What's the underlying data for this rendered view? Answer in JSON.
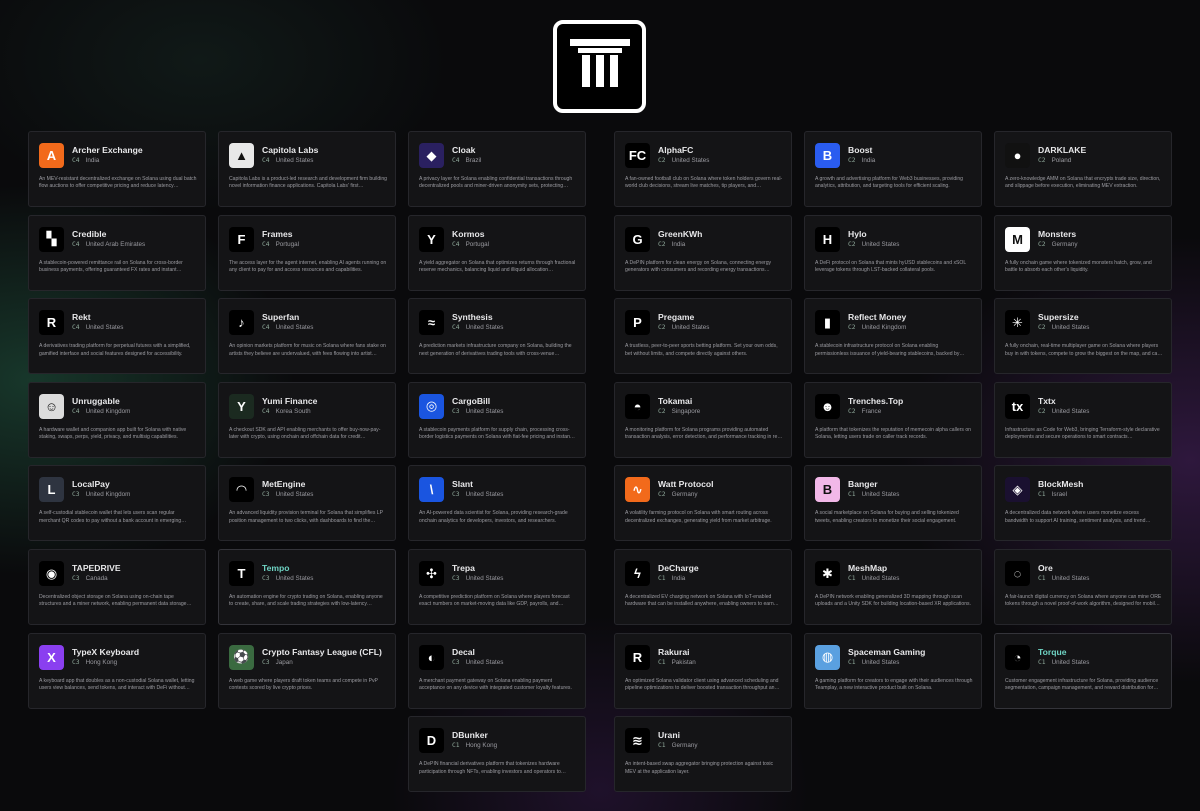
{
  "logo": {
    "name": "pillars-logo-icon"
  },
  "cards": [
    {
      "name": "Archer Exchange",
      "tier": "C4",
      "country": "India",
      "desc": "An MEV-resistant decentralized exchange on Solana using dual batch flow auctions to offer competitive pricing and reduce latency…",
      "icon": "archer-icon",
      "color": "#f26a1b",
      "glyph": "A"
    },
    {
      "name": "Capitola Labs",
      "tier": "C4",
      "country": "United States",
      "desc": "Capitola Labs is a product-led research and development firm building novel information finance applications. Capitola Labs' first…",
      "icon": "capitola-icon",
      "color": "#e8e8e8",
      "glyph": "▲"
    },
    {
      "name": "Cloak",
      "tier": "C4",
      "country": "Brazil",
      "desc": "A privacy layer for Solana enabling confidential transactions through decentralized pools and miner-driven anonymity sets, protecting…",
      "icon": "cloak-icon",
      "color": "#2a2060",
      "glyph": "◆"
    },
    {
      "name": "AlphaFC",
      "tier": "C2",
      "country": "United States",
      "desc": "A fan-owned football club on Solana where token holders govern real-world club decisions, stream live matches, tip players, and…",
      "icon": "alphafc-icon",
      "color": "#000000",
      "glyph": "FC"
    },
    {
      "name": "Boost",
      "tier": "C2",
      "country": "India",
      "desc": "A growth and advertising platform for Web3 businesses, providing analytics, attribution, and targeting tools for efficient scaling.",
      "icon": "boost-icon",
      "color": "#2a5cf0",
      "glyph": "B"
    },
    {
      "name": "DARKLAKE",
      "tier": "C2",
      "country": "Poland",
      "desc": "A zero-knowledge AMM on Solana that encrypts trade size, direction, and slippage before execution, eliminating MEV extraction.",
      "icon": "darklake-icon",
      "color": "#111111",
      "glyph": "●"
    },
    {
      "name": "Credible",
      "tier": "C4",
      "country": "United Arab Emirates",
      "desc": "A stablecoin-powered remittance rail on Solana for cross-border business payments, offering guaranteed FX rates and instant…",
      "icon": "credible-icon",
      "color": "#000000",
      "glyph": "▚"
    },
    {
      "name": "Frames",
      "tier": "C4",
      "country": "Portugal",
      "desc": "The access layer for the agent internet, enabling AI agents running on any client to pay for and access resources and capabilities.",
      "icon": "frames-icon",
      "color": "#000000",
      "glyph": "F"
    },
    {
      "name": "Kormos",
      "tier": "C4",
      "country": "Portugal",
      "desc": "A yield aggregator on Solana that optimizes returns through fractional reserve mechanics, balancing liquid and illiquid allocation…",
      "icon": "kormos-icon",
      "color": "#000000",
      "glyph": "Y"
    },
    {
      "name": "GreenKWh",
      "tier": "C2",
      "country": "India",
      "desc": "A DePIN platform for clean energy on Solana, connecting energy generators with consumers and recording energy transactions…",
      "icon": "greenkwh-icon",
      "color": "#000000",
      "glyph": "G"
    },
    {
      "name": "Hylo",
      "tier": "C2",
      "country": "United States",
      "desc": "A DeFi protocol on Solana that mints hyUSD stablecoins and xSOL leverage tokens through LST-backed collateral pools.",
      "icon": "hylo-icon",
      "color": "#000000",
      "glyph": "H"
    },
    {
      "name": "Monsters",
      "tier": "C2",
      "country": "Germany",
      "desc": "A fully onchain game where tokenized monsters hatch, grow, and battle to absorb each other's liquidity.",
      "icon": "monsters-icon",
      "color": "#ffffff",
      "glyph": "M"
    },
    {
      "name": "Rekt",
      "tier": "C4",
      "country": "United States",
      "desc": "A derivatives trading platform for perpetual futures with a simplified, gamified interface and social features designed for accessibility.",
      "icon": "rekt-icon",
      "color": "#000000",
      "glyph": "R"
    },
    {
      "name": "Superfan",
      "tier": "C4",
      "country": "United States",
      "desc": "An opinion markets platform for music on Solana where fans stake on artists they believe are undervalued, with fees flowing into artist…",
      "icon": "superfan-icon",
      "color": "#000000",
      "glyph": "♪"
    },
    {
      "name": "Synthesis",
      "tier": "C4",
      "country": "United States",
      "desc": "A prediction markets infrastructure company on Solana, building the next generation of derivatives trading tools with cross-venue…",
      "icon": "synthesis-icon",
      "color": "#000000",
      "glyph": "≈"
    },
    {
      "name": "Pregame",
      "tier": "C2",
      "country": "United States",
      "desc": "A trustless, peer-to-peer sports betting platform. Set your own odds, bet without limits, and compete directly against others.",
      "icon": "pregame-icon",
      "color": "#000000",
      "glyph": "P"
    },
    {
      "name": "Reflect Money",
      "tier": "C2",
      "country": "United Kingdom",
      "desc": "A stablecoin infrastructure protocol on Solana enabling permissionless issuance of yield-bearing stablecoins, backed by…",
      "icon": "reflect-icon",
      "color": "#000000",
      "glyph": "▮"
    },
    {
      "name": "Supersize",
      "tier": "C2",
      "country": "United States",
      "desc": "A fully onchain, real-time multiplayer game on Solana where players buy in with tokens, compete to grow the biggest on the map, and ca…",
      "icon": "supersize-icon",
      "color": "#000000",
      "glyph": "✳"
    },
    {
      "name": "Unruggable",
      "tier": "C4",
      "country": "United Kingdom",
      "desc": "A hardware wallet and companion app built for Solana with native staking, swaps, perps, yield, privacy, and multisig capabilities.",
      "icon": "unruggable-icon",
      "color": "#dcdcdc",
      "glyph": "☺"
    },
    {
      "name": "Yumi Finance",
      "tier": "C4",
      "country": "Korea South",
      "desc": "A checkout SDK and API enabling merchants to offer buy-now-pay-later with crypto, using onchain and offchain data for credit…",
      "icon": "yumi-icon",
      "color": "#1b2a20",
      "glyph": "Y"
    },
    {
      "name": "CargoBill",
      "tier": "C3",
      "country": "United States",
      "desc": "A stablecoin payments platform for supply chain, processing cross-border logistics payments on Solana with fiat-fee pricing and instan…",
      "icon": "cargobill-icon",
      "color": "#1a55e0",
      "glyph": "◎"
    },
    {
      "name": "Tokamai",
      "tier": "C2",
      "country": "Singapore",
      "desc": "A monitoring platform for Solana programs providing automated transaction analysis, error detection, and performance tracking in re…",
      "icon": "tokamai-icon",
      "color": "#000000",
      "glyph": "◓"
    },
    {
      "name": "Trenches.Top",
      "tier": "C2",
      "country": "France",
      "desc": "A platform that tokenizes the reputation of memecoin alpha callers on Solana, letting users trade on caller track records.",
      "icon": "trenches-icon",
      "color": "#000000",
      "glyph": "☻"
    },
    {
      "name": "Txtx",
      "tier": "C2",
      "country": "United States",
      "desc": "Infrastructure as Code for Web3, bringing Terraform-style declarative deployments and secure operations to smart contracts…",
      "icon": "txtx-icon",
      "color": "#000000",
      "glyph": "tx"
    },
    {
      "name": "LocalPay",
      "tier": "C3",
      "country": "United Kingdom",
      "desc": "A self-custodial stablecoin wallet that lets users scan regular merchant QR codes to pay without a bank account in emerging…",
      "icon": "localpay-icon",
      "color": "#2e3440",
      "glyph": "L"
    },
    {
      "name": "MetEngine",
      "tier": "C3",
      "country": "United States",
      "desc": "An advanced liquidity provision terminal for Solana that simplifies LP position management to two clicks, with dashboards to find the…",
      "icon": "metengine-icon",
      "color": "#000000",
      "glyph": "◠"
    },
    {
      "name": "Slant",
      "tier": "C3",
      "country": "United States",
      "desc": "An AI-powered data scientist for Solana, providing research-grade onchain analytics for developers, investors, and researchers.",
      "icon": "slant-icon",
      "color": "#1a55e0",
      "glyph": "\\"
    },
    {
      "name": "Watt Protocol",
      "tier": "C2",
      "country": "Germany",
      "desc": "A volatility farming protocol on Solana with smart routing across decentralized exchanges, generating yield from market arbitrage.",
      "icon": "watt-icon",
      "color": "#f26a1b",
      "glyph": "∿"
    },
    {
      "name": "Banger",
      "tier": "C1",
      "country": "United States",
      "desc": "A social marketplace on Solana for buying and selling tokenized tweets, enabling creators to monetize their social engagement.",
      "icon": "banger-icon",
      "color": "#f2b8e8",
      "glyph": "B"
    },
    {
      "name": "BlockMesh",
      "tier": "C1",
      "country": "Israel",
      "desc": "A decentralized data network where users monetize excess bandwidth to support AI training, sentiment analysis, and trend…",
      "icon": "blockmesh-icon",
      "color": "#1a1030",
      "glyph": "◈"
    },
    {
      "name": "TAPEDRIVE",
      "tier": "C3",
      "country": "Canada",
      "desc": "Decentralized object storage on Solana using on-chain tape structures and a miner network, enabling permanent data storage…",
      "icon": "tapedrive-icon",
      "color": "#000000",
      "glyph": "◉"
    },
    {
      "name": "Tempo",
      "tier": "C3",
      "country": "United States",
      "desc": "An automation engine for crypto trading on Solana, enabling anyone to create, share, and scale trading strategies with low-latency…",
      "icon": "tempo-icon",
      "color": "#000000",
      "glyph": "T"
    },
    {
      "name": "Trepa",
      "tier": "C3",
      "country": "United States",
      "desc": "A competitive prediction platform on Solana where players forecast exact numbers on market-moving data like GDP, payrolls, and…",
      "icon": "trepa-icon",
      "color": "#000000",
      "glyph": "✣"
    },
    {
      "name": "DeCharge",
      "tier": "C1",
      "country": "India",
      "desc": "A decentralized EV charging network on Solana with IoT-enabled hardware that can be installed anywhere, enabling owners to earn…",
      "icon": "decharge-icon",
      "color": "#000000",
      "glyph": "ϟ"
    },
    {
      "name": "MeshMap",
      "tier": "C1",
      "country": "United States",
      "desc": "A DePIN network enabling generalized 3D mapping through scan uploads and a Unity SDK for building location-based XR applications.",
      "icon": "meshmap-icon",
      "color": "#000000",
      "glyph": "✱"
    },
    {
      "name": "Ore",
      "tier": "C1",
      "country": "United States",
      "desc": "A fair-launch digital currency on Solana where anyone can mine ORE tokens through a novel proof-of-work algorithm, designed for mobil…",
      "icon": "ore-icon",
      "color": "#000000",
      "glyph": "◌"
    },
    {
      "name": "TypeX Keyboard",
      "tier": "C3",
      "country": "Hong Kong",
      "desc": "A keyboard app that doubles as a non-custodial Solana wallet, letting users view balances, send tokens, and interact with DeFi without…",
      "icon": "typex-icon",
      "color": "#8a3ff0",
      "glyph": "X"
    },
    {
      "name": "Crypto Fantasy League (CFL)",
      "tier": "C3",
      "country": "Japan",
      "desc": "A web game where players draft token teams and compete in PvP contests scored by live crypto prices.",
      "icon": "cfl-icon",
      "color": "#3a6a40",
      "glyph": "⚽"
    },
    {
      "name": "Decal",
      "tier": "C3",
      "country": "United States",
      "desc": "A merchant payment gateway on Solana enabling payment acceptance on any device with integrated customer loyalty features.",
      "icon": "decal-icon",
      "color": "#000000",
      "glyph": "◐"
    },
    {
      "name": "Rakurai",
      "tier": "C1",
      "country": "Pakistan",
      "desc": "An optimized Solana validator client using advanced scheduling and pipeline optimizations to deliver boosted transaction throughput an…",
      "icon": "rakurai-icon",
      "color": "#000000",
      "glyph": "R"
    },
    {
      "name": "Spaceman Gaming",
      "tier": "C1",
      "country": "United States",
      "desc": "A gaming platform for creators to engage with their audiences through Teamplay, a new interactive product built on Solana.",
      "icon": "spaceman-icon",
      "color": "#5aa0e0",
      "glyph": "◍"
    },
    {
      "name": "Torque",
      "tier": "C1",
      "country": "United States",
      "desc": "Customer engagement infrastructure for Solana, providing audience segmentation, campaign management, and reward distribution for…",
      "icon": "torque-icon",
      "color": "#000000",
      "glyph": "◔"
    },
    {
      "name": "DBunker",
      "tier": "C1",
      "country": "Hong Kong",
      "desc": "A DePIN financial derivatives platform that tokenizes hardware participation through NFTs, enabling investors and operators to…",
      "icon": "dbunker-icon",
      "color": "#000000",
      "glyph": "D"
    },
    {
      "name": "Urani",
      "tier": "C1",
      "country": "Germany",
      "desc": "An intent-based swap aggregator bringing protection against toxic MEV at the application layer.",
      "icon": "urani-icon",
      "color": "#000000",
      "glyph": "≋"
    }
  ]
}
